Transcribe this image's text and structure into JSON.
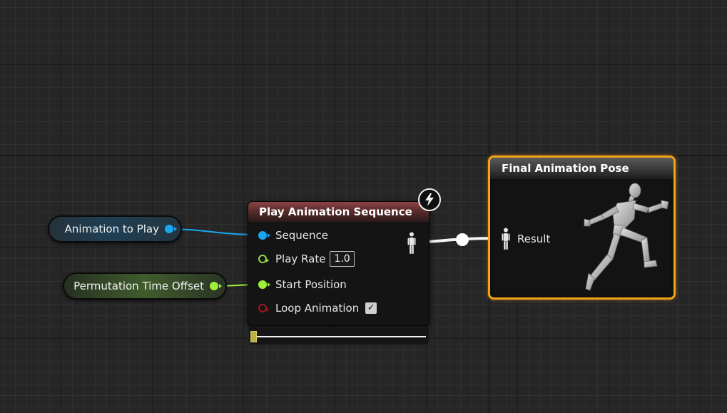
{
  "variables": {
    "animation_to_play": "Animation to Play",
    "permutation_time_offset": "Permutation Time Offset"
  },
  "play_node": {
    "title": "Play Animation Sequence",
    "pins": {
      "sequence": "Sequence",
      "play_rate": "Play Rate",
      "play_rate_value": "1.0",
      "start_position": "Start Position",
      "loop_animation": "Loop Animation"
    },
    "loop_checked": true,
    "badge_icon": "lightning-icon",
    "timeline_position": 0.0
  },
  "final_node": {
    "title": "Final Animation Pose",
    "result_label": "Result"
  },
  "colors": {
    "pin_object": "#1aa7f0",
    "pin_float": "#9ef03a",
    "pin_bool": "#a01818",
    "selection_outline": "#f2a31a",
    "play_header": "#8e4444"
  }
}
